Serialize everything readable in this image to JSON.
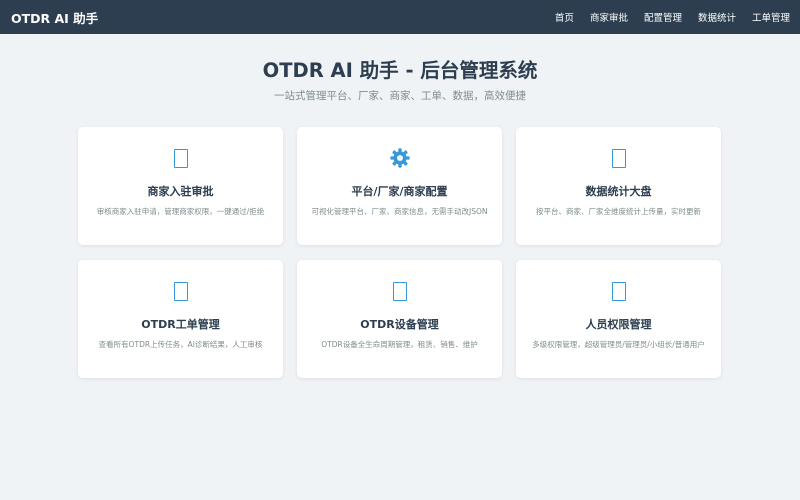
{
  "navbar": {
    "brand": "OTDR AI 助手",
    "links": [
      "首页",
      "商家审批",
      "配置管理",
      "数据统计",
      "工单管理"
    ]
  },
  "hero": {
    "title": "OTDR AI 助手 - 后台管理系统",
    "subtitle": "一站式管理平台、厂家、商家、工单、数据，高效便捷"
  },
  "cards": [
    {
      "icon": "document-icon",
      "title": "商家入驻审批",
      "desc": "审核商家入驻申请，管理商家权限，一键通过/拒绝"
    },
    {
      "icon": "gear-icon",
      "title": "平台/厂家/商家配置",
      "desc": "可视化管理平台、厂家、商家信息，无需手动改JSON"
    },
    {
      "icon": "chart-icon",
      "title": "数据统计大盘",
      "desc": "按平台、商家、厂家全维度统计上传量，实时更新"
    },
    {
      "icon": "ticket-icon",
      "title": "OTDR工单管理",
      "desc": "查看所有OTDR上传任务，AI诊断结果，人工审核"
    },
    {
      "icon": "device-icon",
      "title": "OTDR设备管理",
      "desc": "OTDR设备全生命周期管理，租赁、销售、维护"
    },
    {
      "icon": "users-icon",
      "title": "人员权限管理",
      "desc": "多级权限管理，超级管理员/管理员/小组长/普通用户"
    }
  ],
  "colors": {
    "navbar": "#2c3e50",
    "accent": "#3498db",
    "background": "#f0f3f6"
  }
}
